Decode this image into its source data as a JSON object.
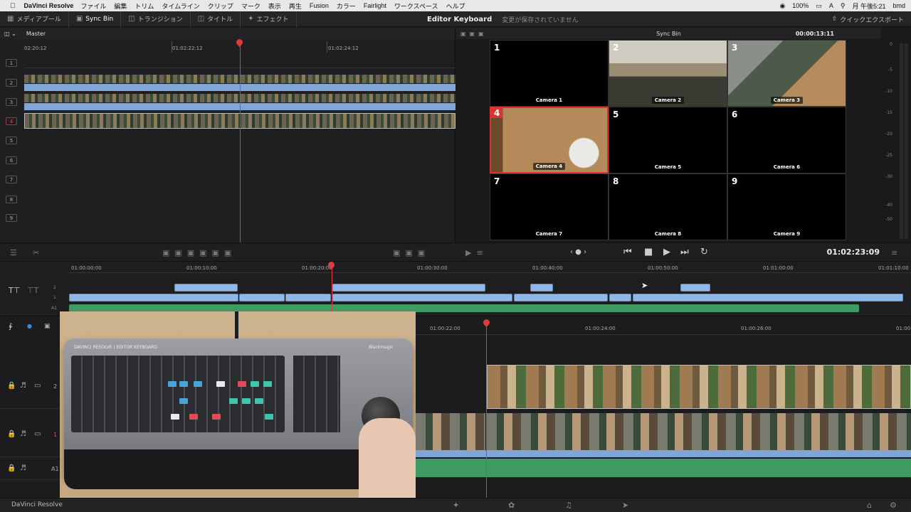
{
  "menubar": {
    "apple": "",
    "app_name": "DaVinci Resolve",
    "items": [
      "ファイル",
      "編集",
      "トリム",
      "タイムライン",
      "クリップ",
      "マーク",
      "表示",
      "再生",
      "Fusion",
      "カラー",
      "Fairlight",
      "ワークスペース",
      "ヘルプ"
    ],
    "battery": "100%",
    "input_source": "A",
    "clock": "月 午後5:21",
    "user": "bmd"
  },
  "toolbar": {
    "media_pool": "メディアプール",
    "sync_bin": "Sync Bin",
    "transitions": "トランジション",
    "titles": "タイトル",
    "effects": "エフェクト",
    "project_title": "Editor Keyboard",
    "status": "変更が保存されていません",
    "quick_export": "クイックエクスポート"
  },
  "source": {
    "label": "Master",
    "ruler": [
      "02:20:12",
      "01:02:22:12",
      "01:02:24:12"
    ],
    "tracks": [
      "1",
      "2",
      "3",
      "4",
      "5",
      "6",
      "7",
      "8",
      "9"
    ]
  },
  "viewer": {
    "title": "Sync Bin",
    "timecode": "00:00:13:11",
    "cameras": [
      {
        "num": "1",
        "label": "Camera 1"
      },
      {
        "num": "2",
        "label": "Camera 2"
      },
      {
        "num": "3",
        "label": "Camera 3"
      },
      {
        "num": "4",
        "label": "Camera 4"
      },
      {
        "num": "5",
        "label": "Camera 5"
      },
      {
        "num": "6",
        "label": "Camera 6"
      },
      {
        "num": "7",
        "label": "Camera 7"
      },
      {
        "num": "8",
        "label": "Camera 8"
      },
      {
        "num": "9",
        "label": "Camera 9"
      }
    ],
    "active_camera": "4"
  },
  "meters": {
    "scale": [
      "0",
      "-5",
      "-10",
      "-15",
      "-20",
      "-25",
      "-30",
      "-40",
      "-50"
    ]
  },
  "transport": {
    "timecode": "01:02:23:09"
  },
  "upper_timeline": {
    "ruler": [
      "01:00:00:00",
      "01:00:10:00",
      "01:00:20:00",
      "01:00:30:00",
      "01:00:40:00",
      "01:00:50:00",
      "01:01:00:00",
      "01:01:10:00"
    ],
    "track_labels": [
      "2",
      "1",
      "A1"
    ]
  },
  "lower_timeline": {
    "ruler": [
      "01:00:22:00",
      "01:00:24:00",
      "01:00:26:00",
      "01:00:"
    ],
    "tracks": [
      {
        "label": "2"
      },
      {
        "label": "1"
      },
      {
        "label": "A1"
      }
    ]
  },
  "inset": {
    "brand_left": "DAVINCI RESOLVE | EDITOR KEYBOARD",
    "brand_right": "Blackmagic"
  },
  "bottombar": {
    "app": "DaVinci Resolve"
  },
  "colors": {
    "playhead": "#e03b3b",
    "clip_blue": "#8fb8e6",
    "clip_green": "#3f9a63",
    "active_border": "#d33333"
  }
}
